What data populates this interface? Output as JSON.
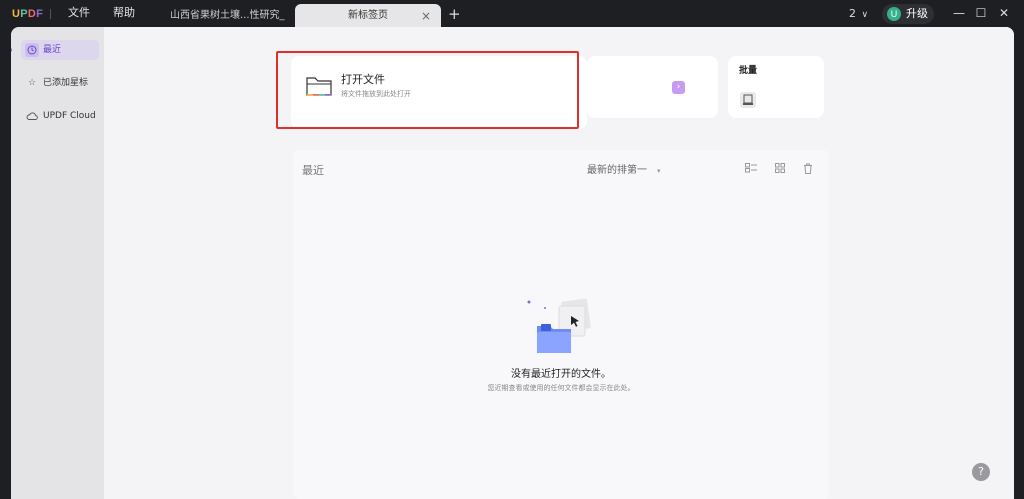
{
  "titlebar": {
    "logo": {
      "letters": [
        "U",
        "P",
        "D",
        "F"
      ],
      "colors": [
        "#f6b73c",
        "#5fc3a4",
        "#ef6b6b",
        "#8a6ad8"
      ]
    },
    "menu": [
      {
        "label": "文件"
      },
      {
        "label": "帮助"
      }
    ],
    "tabs": [
      {
        "label": "山西省果树土壤...性研究_黄芳*",
        "active": false
      },
      {
        "label": "新标签页",
        "active": true,
        "close": "×"
      }
    ],
    "add_tab": "+",
    "window_count": "2",
    "window_count_caret": "∨",
    "avatar_initial": "U",
    "upgrade_label": "升级",
    "window_controls": {
      "minimize": "—",
      "maximize": "☐",
      "close": "✕"
    }
  },
  "sidebar": {
    "items": [
      {
        "label": "最近",
        "icon": "clock-icon",
        "active": true
      },
      {
        "label": "已添加星标",
        "icon": "star-icon",
        "active": false
      },
      {
        "label": "UPDF Cloud",
        "icon": "cloud-icon",
        "active": false
      }
    ]
  },
  "main": {
    "open_file": {
      "title": "打开文件",
      "subtitle": "将文件拖放到此处打开"
    },
    "arrow_label": "›",
    "batch": {
      "title": "批量"
    },
    "recent": {
      "title": "最近",
      "sort": {
        "selected": "最新的排第一",
        "caret": "▾"
      },
      "empty_title": "没有最近打开的文件。",
      "empty_subtitle": "您近期查看或使用的任何文件都会显示在此处。"
    }
  },
  "colors": {
    "accent": "#8a6ad8",
    "highlight": "#e0302a"
  },
  "help_fab": "?"
}
